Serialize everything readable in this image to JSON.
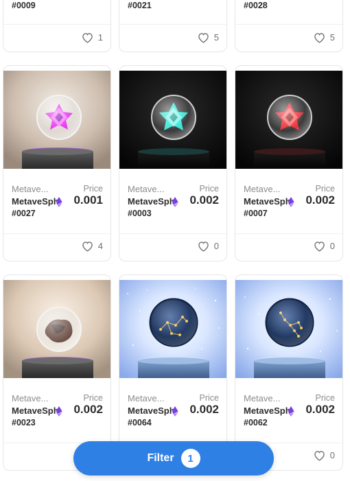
{
  "top_row": [
    {
      "token": "#0009",
      "likes": "1"
    },
    {
      "token": "#0021",
      "likes": "5"
    },
    {
      "token": "#0028",
      "likes": "5"
    }
  ],
  "cards": [
    {
      "collection": "Metave...",
      "price_label": "Price",
      "name": "MetaveSph",
      "price": "0.001",
      "token": "#0027",
      "likes": "4",
      "orb_color": "#e21cf0",
      "bg": "warm"
    },
    {
      "collection": "Metave...",
      "price_label": "Price",
      "name": "MetaveSph",
      "price": "0.002",
      "token": "#0003",
      "likes": "0",
      "orb_color": "#1ce3d2",
      "bg": "dark"
    },
    {
      "collection": "Metave...",
      "price_label": "Price",
      "name": "MetaveSph",
      "price": "0.002",
      "token": "#0007",
      "likes": "0",
      "orb_color": "#e8141c",
      "bg": "dark"
    },
    {
      "collection": "Metave...",
      "price_label": "Price",
      "name": "MetaveSph",
      "price": "0.002",
      "token": "#0023",
      "likes": "",
      "orb_color": "#5a3a30",
      "bg": "warm"
    },
    {
      "collection": "Metave...",
      "price_label": "Price",
      "name": "MetaveSph",
      "price": "0.002",
      "token": "#0064",
      "likes": "",
      "orb_color": "#15305e",
      "bg": "sky"
    },
    {
      "collection": "Metave...",
      "price_label": "Price",
      "name": "MetaveSph",
      "price": "0.002",
      "token": "#0062",
      "likes": "0",
      "orb_color": "#15305e",
      "bg": "sky"
    }
  ],
  "filter": {
    "label": "Filter",
    "count": "1"
  },
  "icons": {
    "like": "heart-outline-icon",
    "currency": "ethereum-icon"
  }
}
